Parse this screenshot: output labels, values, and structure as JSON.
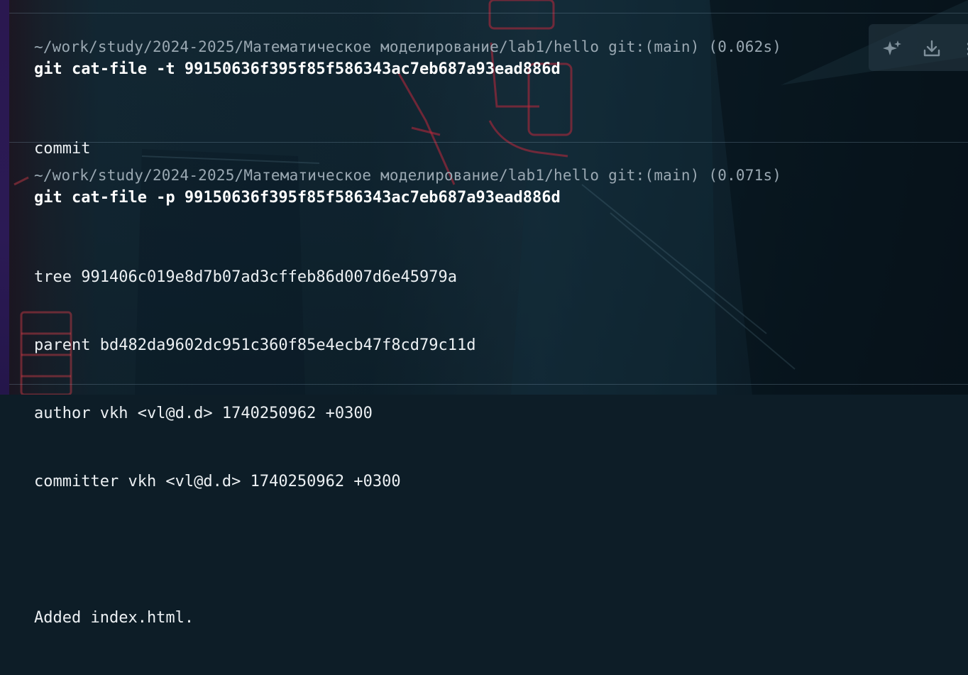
{
  "blocks": [
    {
      "prompt": "~/work/study/2024-2025/Математическое моделирование/lab1/hello git:(main) (0.062s)",
      "command": "git cat-file -t 99150636f395f85f586343ac7eb687a93ead886d",
      "output": [
        "commit"
      ]
    },
    {
      "prompt": "~/work/study/2024-2025/Математическое моделирование/lab1/hello git:(main) (0.071s)",
      "command": "git cat-file -p 99150636f395f85f586343ac7eb687a93ead886d",
      "output": [
        "tree 991406c019e8d7b07ad3cffeb86d007d6e45979a",
        "parent bd482da9602dc951c360f85e4ecb47f8cd79c11d",
        "author vkh <vl@d.d> 1740250962 +0300",
        "committer vkh <vl@d.d> 1740250962 +0300",
        "",
        "Added index.html."
      ]
    }
  ],
  "toolbar": {
    "icons": [
      "sparkle-icon",
      "download-icon",
      "more-icon"
    ]
  },
  "colors": {
    "prompt": "#9aa8b2",
    "command": "#ffffff",
    "output": "#ecf0f3",
    "divider": "#8caabe",
    "left_edge": "#2a1850"
  }
}
